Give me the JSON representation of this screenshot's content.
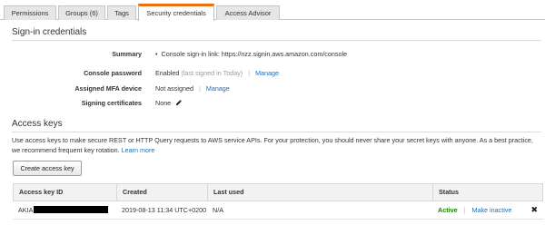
{
  "tabs": [
    {
      "label": "Permissions"
    },
    {
      "label": "Groups (6)"
    },
    {
      "label": "Tags"
    },
    {
      "label": "Security credentials",
      "active": true
    },
    {
      "label": "Access Advisor"
    }
  ],
  "signin": {
    "title": "Sign-in credentials",
    "summary_label": "Summary",
    "summary_prefix": "Console sign-in link:",
    "summary_url": "https://nzz.signin.aws.amazon.com/console",
    "console_password_label": "Console password",
    "console_password_status": "Enabled",
    "console_password_note": "(last signed in Today)",
    "console_password_sep": "|",
    "console_password_manage": "Manage",
    "mfa_label": "Assigned MFA device",
    "mfa_status": "Not assigned",
    "mfa_sep": "|",
    "mfa_manage": "Manage",
    "signing_label": "Signing certificates",
    "signing_value": "None"
  },
  "access_keys": {
    "title": "Access keys",
    "description": "Use access keys to make secure REST or HTTP Query requests to AWS service APIs. For your protection, you should never share your secret keys with anyone. As a best practice, we recommend frequent key rotation.",
    "learn_more": "Learn more",
    "create_button": "Create access key",
    "columns": [
      "Access key ID",
      "Created",
      "Last used",
      "Status"
    ],
    "rows": [
      {
        "key_prefix": "AKIA",
        "created": "2019-08-13 11:34 UTC+0200",
        "last_used": "N/A",
        "status": "Active",
        "sep": "|",
        "action": "Make inactive",
        "delete": "✖"
      }
    ]
  },
  "colors": {
    "accent_tab": "#ec7211",
    "link": "#1a6fc0",
    "status_active": "#1d8102"
  },
  "icons": {
    "pencil": "pencil-icon",
    "delete": "close-icon"
  }
}
